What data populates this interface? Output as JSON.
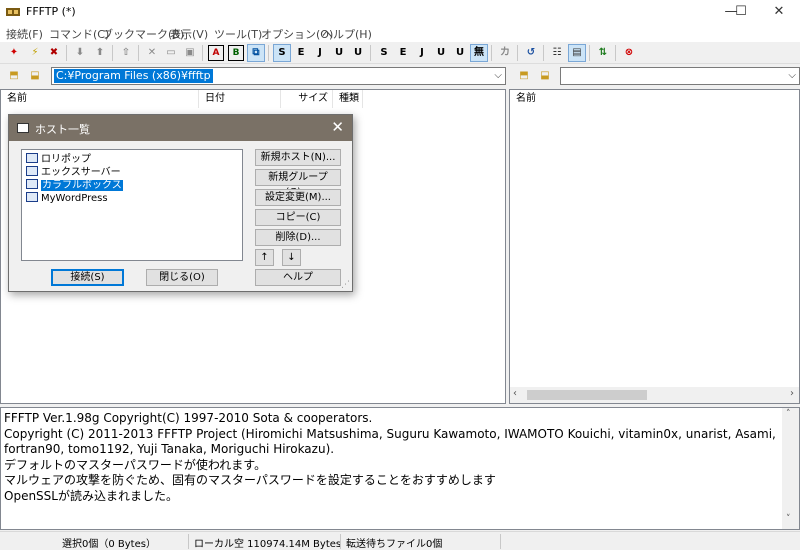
{
  "window": {
    "title": "FFFTP (*)",
    "controls": {
      "minimize": "—",
      "maximize": "☐",
      "close": "✕"
    }
  },
  "menu": [
    "接続(F)",
    "コマンド(C)",
    "ブックマーク(B)",
    "表示(V)",
    "ツール(T)",
    "オプション(O)",
    "ヘルプ(H)"
  ],
  "toolbar": {
    "transfer_modes": [
      "S",
      "E",
      "J",
      "U",
      "U"
    ],
    "code_labels": [
      "A",
      "B"
    ],
    "nocode_label": "無",
    "kana_label": "カ"
  },
  "local": {
    "path": "C:¥Program Files (x86)¥ffftp",
    "columns": {
      "name": "名前",
      "date": "日付",
      "size": "サイズ",
      "type": "種類"
    }
  },
  "remote": {
    "path": "",
    "columns": {
      "name": "名前"
    }
  },
  "dialog": {
    "title": "ホスト一覧",
    "hosts": [
      "ロリポップ",
      "エックスサーバー",
      "カラフルボックス",
      "MyWordPress"
    ],
    "selected_index": 2,
    "buttons": {
      "new_host": "新規ホスト(N)...",
      "new_group": "新規グループ(G)...",
      "edit": "設定変更(M)...",
      "copy": "コピー(C)",
      "delete": "削除(D)...",
      "up": "↑",
      "down": "↓",
      "connect": "接続(S)",
      "close": "閉じる(O)",
      "help": "ヘルプ"
    }
  },
  "log": [
    "FFFTP Ver.1.98g Copyright(C) 1997-2010 Sota & cooperators.",
    "Copyright (C) 2011-2013 FFFTP Project (Hiromichi Matsushima, Suguru Kawamoto, IWAMOTO Kouichi, vitamin0x, unarist, Asami,",
    "fortran90, tomo1192, Yuji Tanaka, Moriguchi Hirokazu).",
    "デフォルトのマスターパスワードが使われます。",
    "マルウェアの攻撃を防ぐため、固有のマスターパスワードを設定することをおすすめします",
    "OpenSSLが読み込まれました。"
  ],
  "status": {
    "selection": "選択0個（0 Bytes）",
    "local_free": "ローカル空 110974.14M Bytes",
    "queue": "転送待ちファイル0個"
  }
}
